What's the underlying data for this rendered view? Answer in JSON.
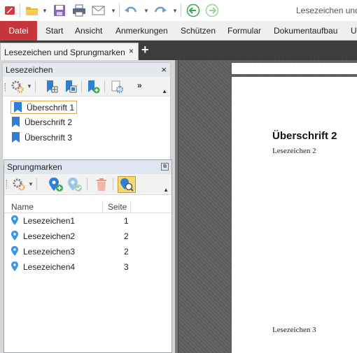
{
  "window": {
    "title": "Lesezeichen und"
  },
  "ribbon": {
    "file_tab": "Datei",
    "tabs": [
      "Start",
      "Ansicht",
      "Anmerkungen",
      "Schützen",
      "Formular",
      "Dokumentaufbau",
      "U"
    ]
  },
  "document_tab": {
    "label": "Lesezeichen und Sprungmarken",
    "close": "×",
    "add": "+"
  },
  "bookmarks_panel": {
    "title": "Lesezeichen",
    "close": "×",
    "items": [
      {
        "label": "Überschrift 1",
        "selected": true
      },
      {
        "label": "Überschrift 2",
        "selected": false
      },
      {
        "label": "Überschrift 3",
        "selected": false
      }
    ]
  },
  "destinations_panel": {
    "title": "Sprungmarken",
    "columns": {
      "name": "Name",
      "page": "Seite"
    },
    "rows": [
      {
        "name": "Lesezeichen1",
        "page": "1"
      },
      {
        "name": "Lesezeichen2",
        "page": "2"
      },
      {
        "name": "Lesezeichen3",
        "page": "2"
      },
      {
        "name": "Lesezeichen4",
        "page": "3"
      }
    ]
  },
  "document": {
    "heading": "Überschrift 2",
    "paragraph_1": "Lesezeichen 2",
    "paragraph_2": "Lesezeichen 3"
  },
  "colors": {
    "accent_file": "#c6363d",
    "bookmark_blue": "#2f7fd6",
    "tabbar": "#3d3d3d"
  }
}
